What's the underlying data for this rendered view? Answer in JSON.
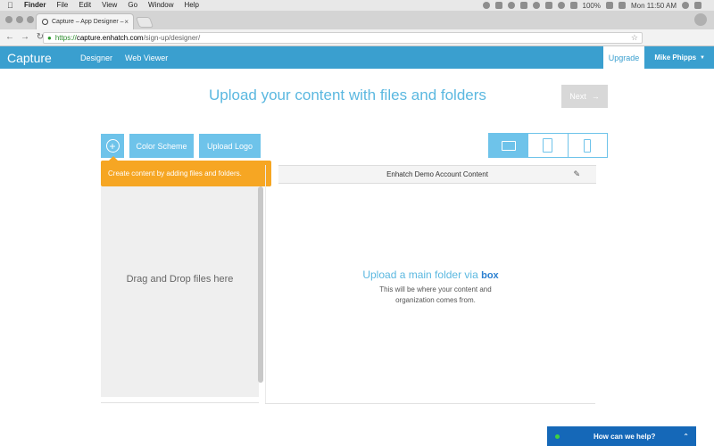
{
  "os_menubar": {
    "items": [
      "Finder",
      "File",
      "Edit",
      "View",
      "Go",
      "Window",
      "Help"
    ],
    "battery": "100%",
    "clock": "Mon 11:50 AM"
  },
  "browser": {
    "tab_title": "Capture – App Designer – ",
    "url_scheme": "https://",
    "url_host": "capture.enhatch.com",
    "url_path": "/sign-up/designer/"
  },
  "app_header": {
    "brand": "Capture",
    "nav": [
      "Designer",
      "Web Viewer"
    ],
    "upgrade_label": "Upgrade",
    "user_name": "Mike Phipps"
  },
  "main": {
    "headline": "Upload your content with files and folders",
    "next_label": "Next",
    "toolbar": {
      "color_scheme_label": "Color Scheme",
      "upload_logo_label": "Upload Logo"
    },
    "device_views": [
      "tablet-landscape",
      "tablet-portrait",
      "phone"
    ],
    "active_device": "tablet-landscape",
    "tooltip": "Create content by adding files and folders.",
    "dropzone_text": "Drag and Drop files here",
    "content_bar_title": "Enhatch Demo Account Content",
    "upload_title": "Upload a main folder via",
    "upload_provider": "box",
    "upload_desc": "This will be where your content and organization comes from."
  },
  "chat": {
    "label": "How can we help?"
  },
  "colors": {
    "header_blue": "#3a9fcf",
    "button_blue": "#6ec3ea",
    "tooltip_orange": "#f6a623",
    "chat_blue": "#1568b8"
  }
}
